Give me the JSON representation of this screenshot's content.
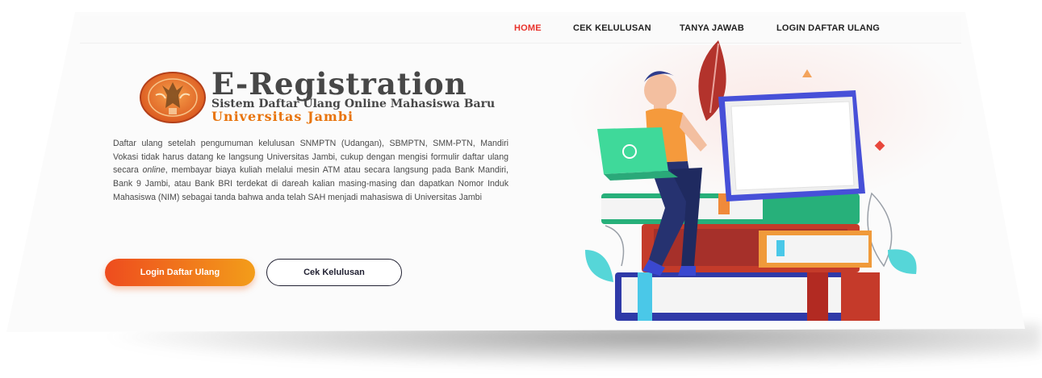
{
  "nav": {
    "items": [
      {
        "label": "HOME",
        "active": true
      },
      {
        "label": "CEK KELULUSAN",
        "active": false
      },
      {
        "label": "TANYA JAWAB",
        "active": false
      },
      {
        "label": "LOGIN DAFTAR ULANG",
        "active": false
      }
    ]
  },
  "hero": {
    "title": "E-Registration",
    "subtitle": "Sistem Daftar Ulang Online Mahasiswa Baru",
    "university": "Universitas Jambi",
    "description_pre": "Daftar ulang setelah pengumuman kelulusan SNMPTN (Udangan), SBMPTN, SMM-PTN, Mandiri Vokasi tidak harus datang ke langsung Universitas Jambi, cukup dengan mengisi formulir daftar ulang secara ",
    "description_em": "online",
    "description_post": ", membayar biaya kuliah melalui mesin ATM atau secara langsung pada Bank Mandiri, Bank 9 Jambi, atau Bank BRI terdekat di dareah kalian masing-masing dan dapatkan Nomor Induk Mahasiswa (NIM) sebagai tanda bahwa anda telah SAH menjadi mahasiswa di Universitas Jambi",
    "btn_login": "Login Daftar Ulang",
    "btn_cek": "Cek Kelulusan"
  },
  "colors": {
    "accent_red": "#e8322b",
    "accent_orange": "#e8740c",
    "text_dark": "#474747"
  },
  "icons": {
    "logo": "universitas-jambi-emblem",
    "illustration": "student-on-books-illustration"
  }
}
